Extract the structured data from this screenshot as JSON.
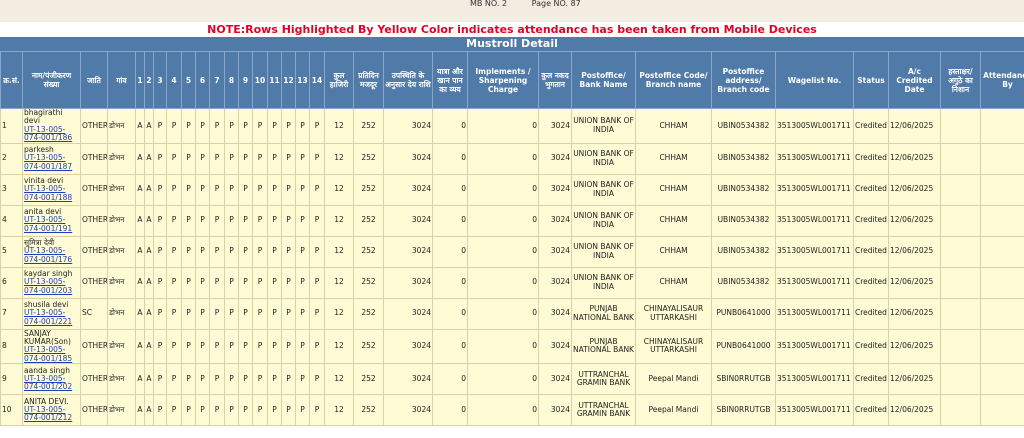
{
  "top": {
    "mb_no": "MB NO.  2",
    "page_no": "Page NO.  87"
  },
  "note": "NOTE:Rows Highlighted By Yellow Color indicates attendance has been taken from Mobile Devices",
  "title": "Mustroll Detail",
  "headers": [
    "क्र.सं.",
    "नाम/पंजीकरण संख्या",
    "जाति",
    "गांव",
    "1",
    "2",
    "3",
    "4",
    "5",
    "6",
    "7",
    "8",
    "9",
    "10",
    "11",
    "12",
    "13",
    "14",
    "कुल हाजिरी",
    "प्रतिदिन मजदूर",
    "उपस्थिति के अनुसार देय राशि",
    "यात्रा और खान पान का व्यय",
    "Implements / Sharpening Charge",
    "कुल नकद भुगतान",
    "Postoffice/ Bank Name",
    "Postoffice Code/ Branch name",
    "Postoffice address/ Branch code",
    "Wagelist No.",
    "Status",
    "A/c Credited Date",
    "हस्ताक्षर/ अगुठे का निशान",
    "Attendance By"
  ],
  "rows": [
    {
      "sn": "1",
      "name": "bhagirathi devi",
      "reg": "UT-13-005-074-001/186",
      "caste": "OTHER",
      "village": "डोभन",
      "att": [
        "A",
        "A",
        "P",
        "P",
        "P",
        "P",
        "P",
        "P",
        "P",
        "P",
        "P",
        "P",
        "P",
        "P"
      ],
      "total": "12",
      "rate": "252",
      "due": "3024",
      "travel": "0",
      "impl": "0",
      "cash": "3024",
      "bank": "UNION BANK OF INDIA",
      "branch": "CHHAM",
      "code": "UBIN0534382",
      "wagelist": "3513005WL001711",
      "status": "Credited",
      "date": "12/06/2025"
    },
    {
      "sn": "2",
      "name": "parkesh",
      "reg": "UT-13-005-074-001/187",
      "caste": "OTHER",
      "village": "डोभन",
      "att": [
        "A",
        "A",
        "P",
        "P",
        "P",
        "P",
        "P",
        "P",
        "P",
        "P",
        "P",
        "P",
        "P",
        "P"
      ],
      "total": "12",
      "rate": "252",
      "due": "3024",
      "travel": "0",
      "impl": "0",
      "cash": "3024",
      "bank": "UNION BANK OF INDIA",
      "branch": "CHHAM",
      "code": "UBIN0534382",
      "wagelist": "3513005WL001711",
      "status": "Credited",
      "date": "12/06/2025"
    },
    {
      "sn": "3",
      "name": "vinita devi",
      "reg": "UT-13-005-074-001/188",
      "caste": "OTHER",
      "village": "डोभन",
      "att": [
        "A",
        "A",
        "P",
        "P",
        "P",
        "P",
        "P",
        "P",
        "P",
        "P",
        "P",
        "P",
        "P",
        "P"
      ],
      "total": "12",
      "rate": "252",
      "due": "3024",
      "travel": "0",
      "impl": "0",
      "cash": "3024",
      "bank": "UNION BANK OF INDIA",
      "branch": "CHHAM",
      "code": "UBIN0534382",
      "wagelist": "3513005WL001711",
      "status": "Credited",
      "date": "12/06/2025"
    },
    {
      "sn": "4",
      "name": "anita devi",
      "reg": "UT-13-005-074-001/191",
      "caste": "OTHER",
      "village": "डोभन",
      "att": [
        "A",
        "A",
        "P",
        "P",
        "P",
        "P",
        "P",
        "P",
        "P",
        "P",
        "P",
        "P",
        "P",
        "P"
      ],
      "total": "12",
      "rate": "252",
      "due": "3024",
      "travel": "0",
      "impl": "0",
      "cash": "3024",
      "bank": "UNION BANK OF INDIA",
      "branch": "CHHAM",
      "code": "UBIN0534382",
      "wagelist": "3513005WL001711",
      "status": "Credited",
      "date": "12/06/2025"
    },
    {
      "sn": "5",
      "name": "सुमित्रा देवी",
      "reg": "UT-13-005-074-001/176",
      "caste": "OTHER",
      "village": "डोभन",
      "att": [
        "A",
        "A",
        "P",
        "P",
        "P",
        "P",
        "P",
        "P",
        "P",
        "P",
        "P",
        "P",
        "P",
        "P"
      ],
      "total": "12",
      "rate": "252",
      "due": "3024",
      "travel": "0",
      "impl": "0",
      "cash": "3024",
      "bank": "UNION BANK OF INDIA",
      "branch": "CHHAM",
      "code": "UBIN0534382",
      "wagelist": "3513005WL001711",
      "status": "Credited",
      "date": "12/06/2025"
    },
    {
      "sn": "6",
      "name": "kaydar singh",
      "reg": "UT-13-005-074-001/203",
      "caste": "OTHER",
      "village": "डोभन",
      "att": [
        "A",
        "A",
        "P",
        "P",
        "P",
        "P",
        "P",
        "P",
        "P",
        "P",
        "P",
        "P",
        "P",
        "P"
      ],
      "total": "12",
      "rate": "252",
      "due": "3024",
      "travel": "0",
      "impl": "0",
      "cash": "3024",
      "bank": "UNION BANK OF INDIA",
      "branch": "CHHAM",
      "code": "UBIN0534382",
      "wagelist": "3513005WL001711",
      "status": "Credited",
      "date": "12/06/2025"
    },
    {
      "sn": "7",
      "name": "shusila devi",
      "reg": "UT-13-005-074-001/221",
      "caste": "SC",
      "village": "डोभन",
      "att": [
        "A",
        "A",
        "P",
        "P",
        "P",
        "P",
        "P",
        "P",
        "P",
        "P",
        "P",
        "P",
        "P",
        "P"
      ],
      "total": "12",
      "rate": "252",
      "due": "3024",
      "travel": "0",
      "impl": "0",
      "cash": "3024",
      "bank": "PUNJAB NATIONAL BANK",
      "branch": "CHINAYALISAUR UTTARKASHI",
      "code": "PUNB0641000",
      "wagelist": "3513005WL001711",
      "status": "Credited",
      "date": "12/06/2025"
    },
    {
      "sn": "8",
      "name": "SANJAY KUMAR(Son)",
      "reg": "UT-13-005-074-001/185",
      "caste": "OTHER",
      "village": "डोभन",
      "att": [
        "A",
        "A",
        "P",
        "P",
        "P",
        "P",
        "P",
        "P",
        "P",
        "P",
        "P",
        "P",
        "P",
        "P"
      ],
      "total": "12",
      "rate": "252",
      "due": "3024",
      "travel": "0",
      "impl": "0",
      "cash": "3024",
      "bank": "PUNJAB NATIONAL BANK",
      "branch": "CHINAYALISAUR UTTARKASHI",
      "code": "PUNB0641000",
      "wagelist": "3513005WL001711",
      "status": "Credited",
      "date": "12/06/2025"
    },
    {
      "sn": "9",
      "name": "aanda singh",
      "reg": "UT-13-005-074-001/202",
      "caste": "OTHER",
      "village": "डोभन",
      "att": [
        "A",
        "A",
        "P",
        "P",
        "P",
        "P",
        "P",
        "P",
        "P",
        "P",
        "P",
        "P",
        "P",
        "P"
      ],
      "total": "12",
      "rate": "252",
      "due": "3024",
      "travel": "0",
      "impl": "0",
      "cash": "3024",
      "bank": "UTTRANCHAL GRAMIN BANK",
      "branch": "Peepal Mandi",
      "code": "SBIN0RRUTGB",
      "wagelist": "3513005WL001711",
      "status": "Credited",
      "date": "12/06/2025"
    },
    {
      "sn": "10",
      "name": "ANITA DEVI.",
      "reg": "UT-13-005-074-001/212",
      "caste": "OTHER",
      "village": "डोभन",
      "att": [
        "A",
        "A",
        "P",
        "P",
        "P",
        "P",
        "P",
        "P",
        "P",
        "P",
        "P",
        "P",
        "P",
        "P"
      ],
      "total": "12",
      "rate": "252",
      "due": "3024",
      "travel": "0",
      "impl": "0",
      "cash": "3024",
      "bank": "UTTRANCHAL GRAMIN BANK",
      "branch": "Peepal Mandi",
      "code": "SBIN0RRUTGB",
      "wagelist": "3513005WL001711",
      "status": "Credited",
      "date": "12/06/2025"
    }
  ]
}
